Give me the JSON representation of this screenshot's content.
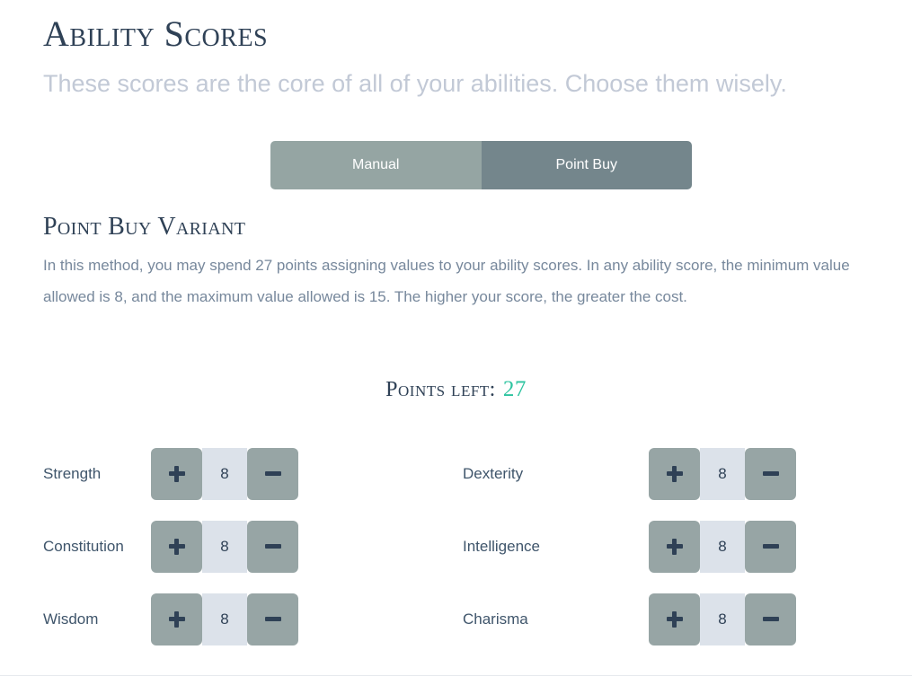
{
  "header": {
    "title": "Ability Scores",
    "subtitle": "These scores are the core of all of your abilities. Choose them wisely."
  },
  "tabs": [
    {
      "label": "Manual",
      "active": false
    },
    {
      "label": "Point Buy",
      "active": true
    }
  ],
  "section": {
    "title": "Point Buy Variant",
    "body": "In this method, you may spend 27 points assigning values to your ability scores. In any ability score, the minimum value allowed is 8, and the maximum value allowed is 15. The higher your score, the greater the cost."
  },
  "points": {
    "label": "Points left:",
    "value": "27",
    "accent_color": "#2ec4a0"
  },
  "abilities": [
    {
      "label": "Strength",
      "value": "8",
      "increase_label": "+",
      "decrease_label": "−"
    },
    {
      "label": "Dexterity",
      "value": "8",
      "increase_label": "+",
      "decrease_label": "−"
    },
    {
      "label": "Constitution",
      "value": "8",
      "increase_label": "+",
      "decrease_label": "−"
    },
    {
      "label": "Intelligence",
      "value": "8",
      "increase_label": "+",
      "decrease_label": "−"
    },
    {
      "label": "Wisdom",
      "value": "8",
      "increase_label": "+",
      "decrease_label": "−"
    },
    {
      "label": "Charisma",
      "value": "8",
      "increase_label": "+",
      "decrease_label": "−"
    }
  ],
  "colors": {
    "title": "#2f4156",
    "subtitle": "#c2c9d6",
    "body_text": "#77889c",
    "tab_inactive": "#95a5a3",
    "tab_active": "#74868c",
    "stepper_button": "#97a5a5",
    "stepper_value_bg": "#dce2ea"
  }
}
